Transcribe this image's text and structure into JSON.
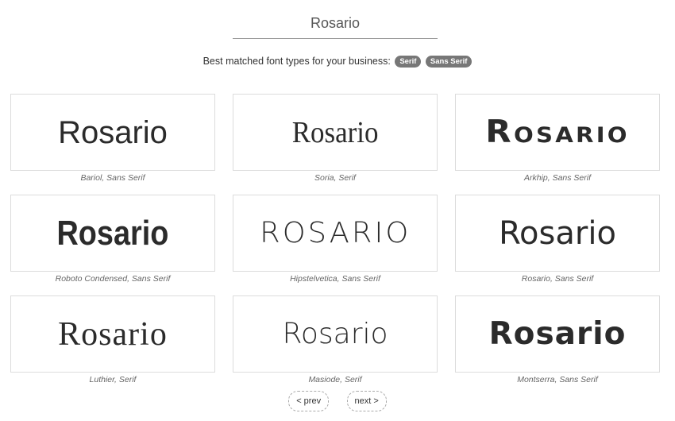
{
  "search": {
    "value": "Rosario"
  },
  "matched": {
    "label": "Best matched font types for your business:",
    "badges": [
      "Serif",
      "Sans Serif"
    ]
  },
  "previews": [
    {
      "text": "Rosario",
      "caption": "Bariol, Sans Serif"
    },
    {
      "text": "Rosario",
      "caption": "Soria, Serif"
    },
    {
      "text": "Rosario",
      "caption": "Arkhip, Sans Serif"
    },
    {
      "text": "Rosario",
      "caption": "Roboto Condensed, Sans Serif"
    },
    {
      "text": "ROSARIO",
      "caption": "Hipstelvetica, Sans Serif"
    },
    {
      "text": "Rosario",
      "caption": "Rosario, Sans Serif"
    },
    {
      "text": "Rosario",
      "caption": "Luthier, Serif"
    },
    {
      "text": "Rosario",
      "caption": "Masiode, Serif"
    },
    {
      "text": "Rosario",
      "caption": "Montserra, Sans Serif"
    }
  ],
  "pager": {
    "prev": "< prev",
    "next": "next >"
  },
  "colors": {
    "badge_bg": "#777777",
    "preview_border": "#dcdcdc",
    "caption_text": "#666666"
  }
}
